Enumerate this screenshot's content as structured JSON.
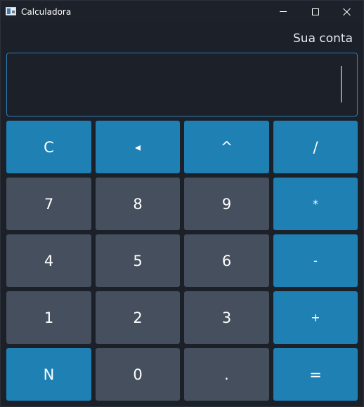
{
  "window": {
    "title": "Calculadora",
    "icon": "calculator-app-icon",
    "controls": [
      "minimize-icon",
      "maximize-icon",
      "close-icon"
    ]
  },
  "header": {
    "account_label": "Sua conta"
  },
  "display": {
    "value": ""
  },
  "colors": {
    "background": "#1b2029",
    "accent_key": "#1f80b4",
    "number_key": "#454f5d",
    "display_border": "#2f7fb8"
  },
  "keypad": {
    "rows": [
      [
        "C",
        "◂",
        "^",
        "/"
      ],
      [
        "7",
        "8",
        "9",
        "*"
      ],
      [
        "4",
        "5",
        "6",
        "-"
      ],
      [
        "1",
        "2",
        "3",
        "+"
      ],
      [
        "N",
        "0",
        ".",
        "="
      ]
    ]
  }
}
